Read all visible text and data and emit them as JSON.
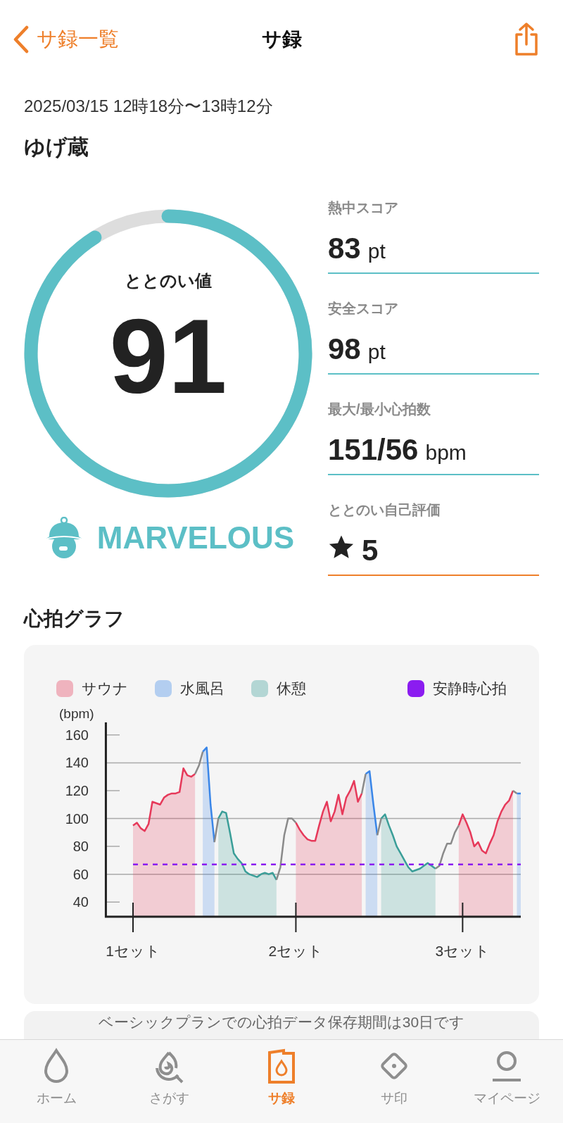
{
  "nav": {
    "back": "サ録一覧",
    "title": "サ録"
  },
  "session": {
    "datetime": "2025/03/15 12時18分〜13時12分",
    "place": "ゆげ蔵"
  },
  "gauge": {
    "label": "ととのい値",
    "value": "91",
    "level": 0.91,
    "rank": "MARVELOUS"
  },
  "scores": [
    {
      "kind": "score",
      "label": "熱中スコア",
      "value": "83",
      "unit": "pt",
      "editable": false
    },
    {
      "kind": "score",
      "label": "安全スコア",
      "value": "98",
      "unit": "pt",
      "editable": false
    },
    {
      "kind": "score",
      "label": "最大/最小心拍数",
      "value": "151/56",
      "unit": "bpm",
      "editable": false
    },
    {
      "kind": "rating",
      "label": "ととのい自己評価",
      "value": "5",
      "editable": true
    }
  ],
  "heart_graph": {
    "title": "心拍グラフ",
    "chart_data": {
      "type": "area",
      "ylabel": "(bpm)",
      "grid": true,
      "categories": [
        "1セット",
        null,
        null,
        null,
        null,
        null,
        null,
        null,
        null,
        null,
        null,
        null,
        null,
        null,
        null,
        null,
        null,
        null,
        null,
        null,
        null,
        null,
        null,
        null,
        null,
        null,
        null,
        null,
        null,
        null,
        null,
        null,
        null,
        null,
        null,
        null,
        null,
        null,
        null,
        null,
        null,
        null,
        "2セット",
        null,
        null,
        null,
        null,
        null,
        null,
        null,
        null,
        null,
        null,
        null,
        null,
        null,
        null,
        null,
        null,
        null,
        null,
        null,
        null,
        null,
        null,
        null,
        null,
        null,
        null,
        null,
        null,
        null,
        null,
        null,
        null,
        null,
        null,
        null,
        null,
        null,
        null,
        null,
        null,
        null,
        null,
        "3セット",
        null,
        null,
        null,
        null,
        null,
        null,
        null,
        null,
        null,
        null,
        null,
        null,
        null,
        null,
        null
      ],
      "ylim": [
        29.5,
        169
      ],
      "yticks": [
        40,
        60,
        80,
        100,
        120,
        140,
        160
      ],
      "series": [
        {
          "name": "サウナ",
          "color": "#e6395a",
          "values": [
            95,
            97,
            93,
            91,
            96,
            112,
            111,
            110,
            115,
            117,
            118,
            118,
            119,
            136,
            131,
            130,
            132,
            null,
            null,
            null,
            null,
            null,
            null,
            null,
            null,
            null,
            null,
            null,
            null,
            null,
            null,
            null,
            null,
            null,
            null,
            null,
            null,
            null,
            null,
            null,
            null,
            null,
            97,
            92,
            88,
            85,
            84,
            84,
            95,
            105,
            112,
            98,
            105,
            117,
            103,
            115,
            120,
            127,
            112,
            118,
            null,
            null,
            null,
            null,
            null,
            null,
            null,
            null,
            null,
            null,
            null,
            null,
            null,
            null,
            null,
            null,
            null,
            null,
            null,
            null,
            null,
            null,
            null,
            null,
            95,
            103,
            97,
            90,
            80,
            83,
            77,
            75,
            82,
            88,
            98,
            105,
            110,
            113,
            120,
            null,
            null
          ]
        },
        {
          "name": "水風呂",
          "color": "#3a86e8",
          "values": [
            null,
            null,
            null,
            null,
            null,
            null,
            null,
            null,
            null,
            null,
            null,
            null,
            null,
            null,
            null,
            null,
            null,
            null,
            148,
            151,
            110,
            83,
            null,
            null,
            null,
            null,
            null,
            null,
            null,
            null,
            null,
            null,
            null,
            null,
            null,
            null,
            null,
            null,
            null,
            null,
            null,
            null,
            null,
            null,
            null,
            null,
            null,
            null,
            null,
            null,
            null,
            null,
            null,
            null,
            null,
            null,
            null,
            null,
            null,
            null,
            132,
            134,
            110,
            88,
            null,
            null,
            null,
            null,
            null,
            null,
            null,
            null,
            null,
            null,
            null,
            null,
            null,
            null,
            null,
            null,
            null,
            null,
            null,
            null,
            null,
            null,
            null,
            null,
            null,
            null,
            null,
            null,
            null,
            null,
            null,
            null,
            null,
            null,
            null,
            118,
            118
          ]
        },
        {
          "name": "休憩",
          "color": "#3a9e98",
          "values": [
            null,
            null,
            null,
            null,
            null,
            null,
            null,
            null,
            null,
            null,
            null,
            null,
            null,
            null,
            null,
            null,
            null,
            null,
            null,
            null,
            null,
            null,
            100,
            105,
            104,
            90,
            75,
            71,
            68,
            62,
            60,
            59,
            58,
            60,
            61,
            60,
            61,
            56,
            null,
            null,
            null,
            null,
            null,
            null,
            null,
            null,
            null,
            null,
            null,
            null,
            null,
            null,
            null,
            null,
            null,
            null,
            null,
            null,
            null,
            null,
            null,
            null,
            null,
            null,
            100,
            103,
            95,
            88,
            80,
            75,
            70,
            65,
            62,
            63,
            64,
            66,
            68,
            66,
            64,
            null,
            null,
            null,
            null,
            null,
            null,
            null,
            null,
            null,
            null,
            null,
            null,
            null,
            null,
            null,
            null,
            null,
            null,
            null,
            null,
            null,
            null
          ]
        },
        {
          "type": "line",
          "color": "#8a8a8a",
          "values": [
            null,
            null,
            null,
            null,
            null,
            null,
            null,
            null,
            null,
            null,
            null,
            null,
            null,
            null,
            null,
            null,
            132,
            138,
            148,
            null,
            null,
            83,
            100,
            null,
            null,
            null,
            null,
            null,
            null,
            null,
            null,
            null,
            null,
            null,
            null,
            null,
            null,
            56,
            65,
            88,
            100,
            100,
            97,
            null,
            null,
            null,
            null,
            null,
            null,
            null,
            null,
            null,
            null,
            null,
            null,
            null,
            null,
            null,
            null,
            118,
            132,
            null,
            null,
            88,
            100,
            null,
            null,
            null,
            null,
            null,
            null,
            null,
            null,
            null,
            null,
            null,
            null,
            null,
            64,
            66,
            75,
            82,
            82,
            90,
            95,
            null,
            null,
            null,
            null,
            null,
            null,
            null,
            null,
            null,
            null,
            null,
            null,
            null,
            120,
            118,
            null
          ]
        },
        {
          "name": "安静時心拍",
          "type": "line",
          "line_style": "dashed",
          "color": "#8b1cf0",
          "values": [
            67,
            67,
            67,
            67,
            67,
            67,
            67,
            67,
            67,
            67,
            67,
            67,
            67,
            67,
            67,
            67,
            67,
            67,
            67,
            67,
            67,
            67,
            67,
            67,
            67,
            67,
            67,
            67,
            67,
            67,
            67,
            67,
            67,
            67,
            67,
            67,
            67,
            67,
            67,
            67,
            67,
            67,
            67,
            67,
            67,
            67,
            67,
            67,
            67,
            67,
            67,
            67,
            67,
            67,
            67,
            67,
            67,
            67,
            67,
            67,
            67,
            67,
            67,
            67,
            67,
            67,
            67,
            67,
            67,
            67,
            67,
            67,
            67,
            67,
            67,
            67,
            67,
            67,
            67,
            67,
            67,
            67,
            67,
            67,
            67,
            67,
            67,
            67,
            67,
            67,
            67,
            67,
            67,
            67,
            67,
            67,
            67,
            67,
            67,
            67,
            67
          ]
        }
      ]
    }
  },
  "notice": "ベーシックプランでの心拍データ保存期間は30日です",
  "tabs": [
    {
      "label": "ホーム",
      "selected": false
    },
    {
      "label": "さがす",
      "selected": false
    },
    {
      "label": "サ録",
      "selected": true
    },
    {
      "label": "サ印",
      "selected": false
    },
    {
      "label": "マイページ",
      "selected": false
    }
  ]
}
